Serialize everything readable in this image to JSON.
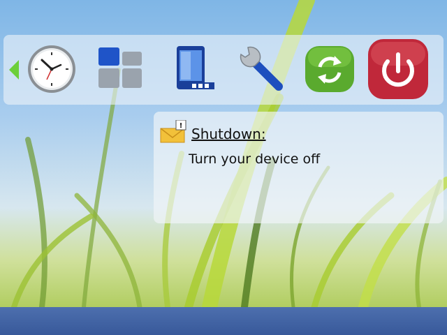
{
  "toolbar": {
    "scroll_left_icon": "chevron-left-icon",
    "apps": [
      {
        "id": "clock",
        "icon": "clock-icon"
      },
      {
        "id": "applications",
        "icon": "app-grid-icon"
      },
      {
        "id": "connectivity",
        "icon": "phone-connectivity-icon"
      },
      {
        "id": "settings",
        "icon": "wrench-icon"
      },
      {
        "id": "sync",
        "icon": "sync-icon"
      },
      {
        "id": "shutdown",
        "icon": "power-icon"
      }
    ]
  },
  "info": {
    "icon": "message-alert-icon",
    "title": "Shutdown:",
    "description": "Turn your device off"
  },
  "colors": {
    "power_red": "#c0283a",
    "sync_green": "#5aaa2e",
    "bottom_bar": "#3f60a0"
  }
}
